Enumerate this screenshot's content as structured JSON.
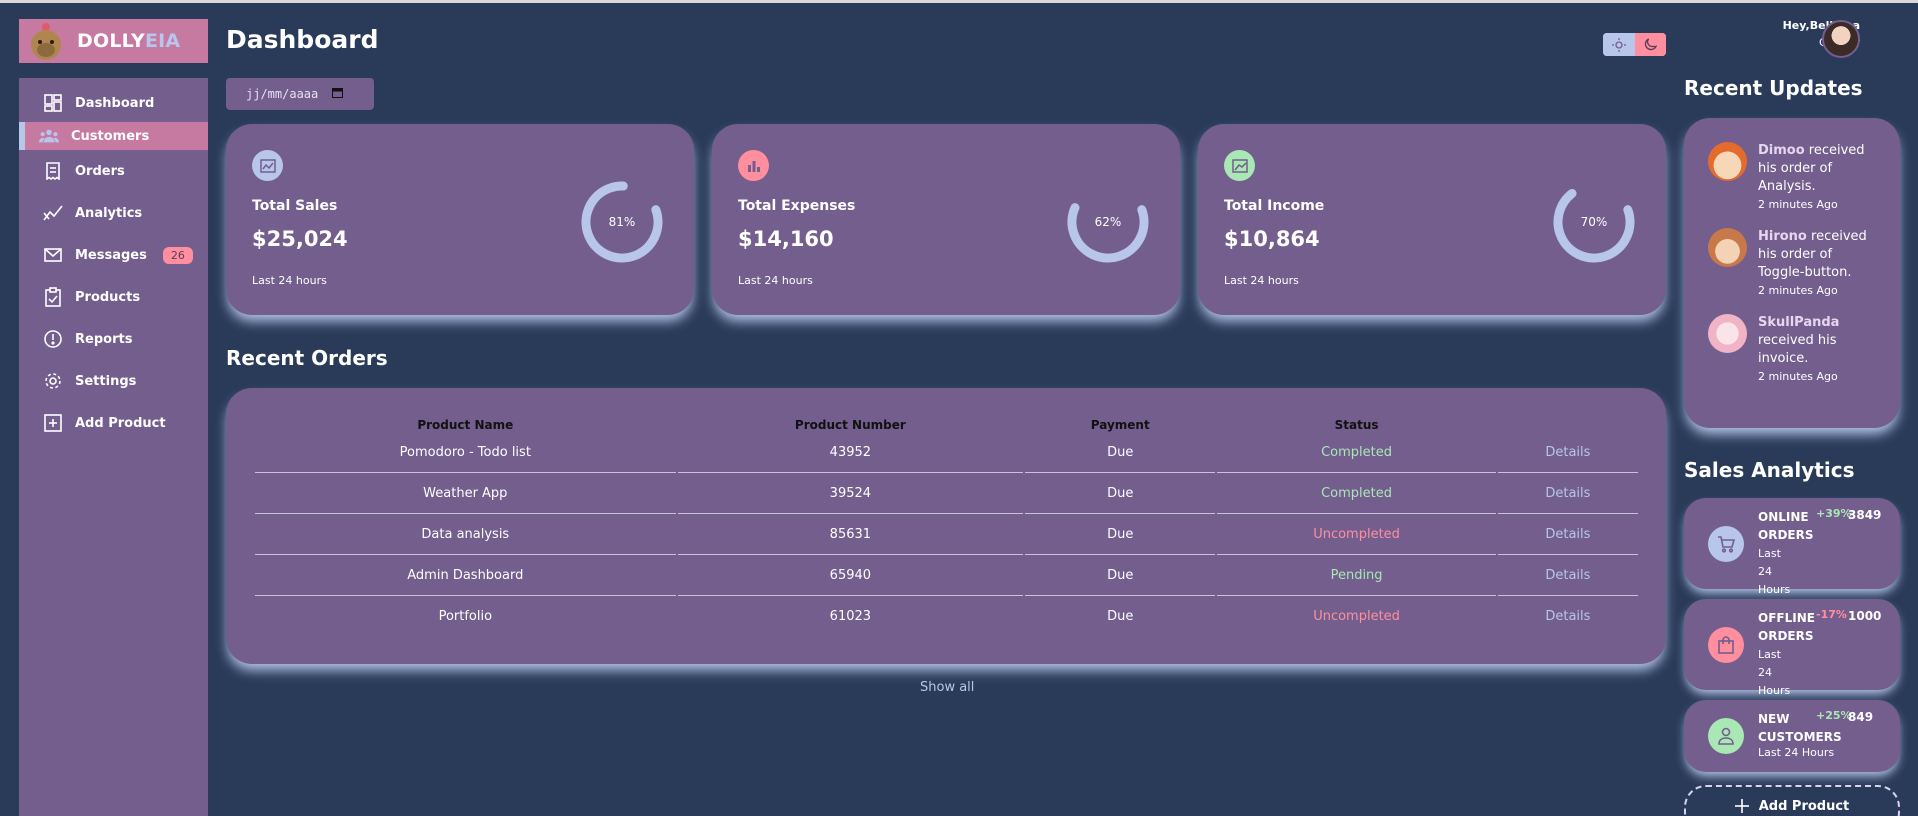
{
  "brand": {
    "name_main": "DOLLY",
    "name_accent": "EIA"
  },
  "sidebar": {
    "items": [
      {
        "label": "Dashboard",
        "icon": "dashboard-icon",
        "active": false
      },
      {
        "label": "Customers",
        "icon": "customers-icon",
        "active": true
      },
      {
        "label": "Orders",
        "icon": "orders-icon",
        "active": false
      },
      {
        "label": "Analytics",
        "icon": "analytics-icon",
        "active": false
      },
      {
        "label": "Messages",
        "icon": "mail-icon",
        "active": false,
        "badge": "26"
      },
      {
        "label": "Products",
        "icon": "clipboard-icon",
        "active": false
      },
      {
        "label": "Reports",
        "icon": "alert-icon",
        "active": false
      },
      {
        "label": "Settings",
        "icon": "gear-icon",
        "active": false
      },
      {
        "label": "Add Product",
        "icon": "add-box-icon",
        "active": false
      }
    ]
  },
  "header": {
    "title": "Dashboard",
    "date_placeholder": "jj/mm/aaaa",
    "greeting_prefix": "Hey,",
    "user_name": "Bellinna",
    "user_role": "Creator"
  },
  "cards": [
    {
      "label": "Total Sales",
      "value": "$25,024",
      "foot": "Last 24 hours",
      "percent": 81,
      "percent_label": "81%",
      "icon": "chart-icon",
      "icon_color": "#b7c6ea"
    },
    {
      "label": "Total Expenses",
      "value": "$14,160",
      "foot": "Last 24 hours",
      "percent": 62,
      "percent_label": "62%",
      "icon": "bar-chart-icon",
      "icon_color": "#ff8f9f"
    },
    {
      "label": "Total Income",
      "value": "$10,864",
      "foot": "Last 24 hours",
      "percent": 70,
      "percent_label": "70%",
      "icon": "stacked-line-icon",
      "icon_color": "#a9e7b5"
    }
  ],
  "orders": {
    "title": "Recent Orders",
    "columns": [
      "Product Name",
      "Product Number",
      "Payment",
      "Status",
      ""
    ],
    "rows": [
      {
        "name": "Pomodoro - Todo list",
        "number": "43952",
        "payment": "Due",
        "status": "Completed",
        "status_kind": "completed",
        "action": "Details"
      },
      {
        "name": "Weather App",
        "number": "39524",
        "payment": "Due",
        "status": "Completed",
        "status_kind": "completed",
        "action": "Details"
      },
      {
        "name": "Data analysis",
        "number": "85631",
        "payment": "Due",
        "status": "Uncompleted",
        "status_kind": "uncompleted",
        "action": "Details"
      },
      {
        "name": "Admin Dashboard",
        "number": "65940",
        "payment": "Due",
        "status": "Pending",
        "status_kind": "pending",
        "action": "Details"
      },
      {
        "name": "Portfolio",
        "number": "61023",
        "payment": "Due",
        "status": "Uncompleted",
        "status_kind": "uncompleted",
        "action": "Details"
      }
    ],
    "show_all": "Show all"
  },
  "updates": {
    "title": "Recent Updates",
    "items": [
      {
        "name": "Dimoo",
        "text": " received his order of Analysis.",
        "time": "2 minutes Ago"
      },
      {
        "name": "Hirono",
        "text": " received his order of Toggle-button.",
        "time": "2 minutes Ago"
      },
      {
        "name": "SkullPanda",
        "text": " received his invoice.",
        "time": "2 minutes Ago"
      }
    ]
  },
  "sales_analytics": {
    "title": "Sales Analytics",
    "items": [
      {
        "title": "ONLINE ORDERS",
        "sub": "Last 24 Hours",
        "pct": "+39%",
        "value": "3849",
        "icon": "cart-icon",
        "icon_color": "#b7c6ea",
        "pct_color": "#a9e7b5"
      },
      {
        "title": "OFFLINE ORDERS",
        "sub": "Last 24 Hours",
        "pct": "-17%",
        "value": "1000",
        "icon": "bag-icon",
        "icon_color": "#ff8f9f",
        "pct_color": "#ff8f9f"
      },
      {
        "title": "NEW CUSTOMERS",
        "sub": "Last 24 Hours",
        "pct": "+25%",
        "value": "849",
        "icon": "person-icon",
        "icon_color": "#a9e7b5",
        "pct_color": "#a9e7b5"
      }
    ],
    "add_label": "Add Product"
  },
  "colors": {
    "background": "#2a3b5a",
    "panel": "#735e8e",
    "accent_pink": "#c67aa2",
    "accent_blue": "#b7c6ea",
    "danger": "#ff8f9f",
    "success": "#a9e7b5"
  }
}
